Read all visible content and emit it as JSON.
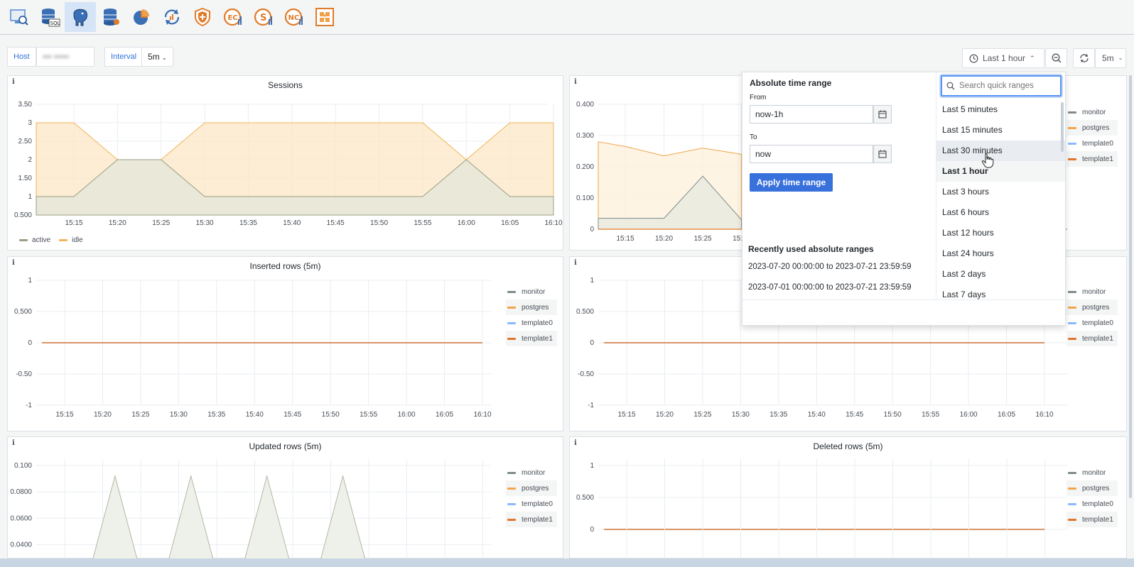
{
  "toolbar": {
    "icons": [
      {
        "name": "monitor-search-icon",
        "color": "#5b8fd3"
      },
      {
        "name": "sql-database-icon",
        "color": "#3a6fb5"
      },
      {
        "name": "postgresql-elephant-icon",
        "color": "#3a6fb5"
      },
      {
        "name": "database-stack-icon",
        "color": "#3a6fb5"
      },
      {
        "name": "pie-chart-icon",
        "color": "#e07b2a"
      },
      {
        "name": "refresh-chart-icon",
        "color": "#3a6fb5"
      },
      {
        "name": "shield-plus-icon",
        "color": "#e07b2a"
      },
      {
        "name": "ec-coin-icon",
        "color": "#e07b2a",
        "text": "EC"
      },
      {
        "name": "s-coin-icon",
        "color": "#e07b2a",
        "text": "S"
      },
      {
        "name": "nc-coin-icon",
        "color": "#e07b2a",
        "text": "NC"
      },
      {
        "name": "puzzle-frame-icon",
        "color": "#e07b2a"
      }
    ]
  },
  "variables": {
    "host_label": "Host",
    "host_value": "••• •••••",
    "interval_label": "Interval",
    "interval_value": "5m"
  },
  "timecontrols": {
    "range_label": "Last 1 hour",
    "refresh_label": "5m"
  },
  "colors": {
    "accent": "#3871dc",
    "monitor": "#7f8b8b",
    "postgres": "#f2a54a",
    "template0": "#8ab8ff",
    "template1": "#e0752d",
    "active": "#9a9f84",
    "idle": "#f2b45a"
  },
  "panels": {
    "sessions": {
      "title": "Sessions",
      "info": "i"
    },
    "top_right": {
      "title": "",
      "info": "i"
    },
    "inserted": {
      "title": "Inserted rows (5m)",
      "info": "i"
    },
    "mid_right": {
      "title": "",
      "info": "i"
    },
    "updated": {
      "title": "Updated rows (5m)",
      "info": "i"
    },
    "deleted": {
      "title": "Deleted rows (5m)",
      "info": "i"
    }
  },
  "legend_db": [
    "monitor",
    "postgres",
    "template0",
    "template1"
  ],
  "legend_sessions": [
    "active",
    "idle"
  ],
  "time_ticks": [
    "15:15",
    "15:20",
    "15:25",
    "15:30",
    "15:35",
    "15:40",
    "15:45",
    "15:50",
    "15:55",
    "16:00",
    "16:05",
    "16:10"
  ],
  "chart_data": [
    {
      "type": "area",
      "title": "Sessions",
      "x": [
        "15:12",
        "15:15",
        "15:20",
        "15:25",
        "15:30",
        "15:35",
        "15:40",
        "15:45",
        "15:50",
        "15:55",
        "16:00",
        "16:05",
        "16:10"
      ],
      "series": [
        {
          "name": "active",
          "values": [
            1,
            1,
            2,
            2,
            1,
            1,
            1,
            1,
            1,
            1,
            2,
            1,
            1
          ]
        },
        {
          "name": "idle",
          "values": [
            3,
            3,
            2,
            2,
            3,
            3,
            3,
            3,
            3,
            3,
            2,
            3,
            3
          ]
        }
      ],
      "yticks": [
        "0.500",
        "1",
        "1.50",
        "2",
        "2.50",
        "3",
        "3.50"
      ],
      "ylim": [
        0.5,
        3.5
      ]
    },
    {
      "type": "area",
      "title": "",
      "x": [
        "15:12",
        "15:15",
        "15:20",
        "15:25",
        "15:30"
      ],
      "series": [
        {
          "name": "postgres",
          "values": [
            0.28,
            0.265,
            0.235,
            0.26,
            0.24
          ]
        },
        {
          "name": "monitor",
          "values": [
            0.035,
            0.035,
            0.035,
            0.17,
            0.03
          ]
        }
      ],
      "yticks": [
        "0",
        "0.100",
        "0.200",
        "0.300",
        "0.400"
      ],
      "ylim": [
        0,
        0.4
      ]
    },
    {
      "type": "line",
      "title": "Inserted rows (5m)",
      "x": [
        "15:15",
        "16:10"
      ],
      "series": [
        {
          "name": "monitor",
          "values": [
            0,
            0
          ]
        },
        {
          "name": "postgres",
          "values": [
            0,
            0
          ]
        },
        {
          "name": "template0",
          "values": [
            0,
            0
          ]
        },
        {
          "name": "template1",
          "values": [
            0,
            0
          ]
        }
      ],
      "yticks": [
        "-1",
        "-0.50",
        "0",
        "0.500",
        "1"
      ],
      "ylim": [
        -1,
        1
      ]
    },
    {
      "type": "line",
      "title": "",
      "x": [
        "15:15",
        "16:10"
      ],
      "series": [
        {
          "name": "monitor",
          "values": [
            0,
            0
          ]
        },
        {
          "name": "postgres",
          "values": [
            0,
            0
          ]
        },
        {
          "name": "template0",
          "values": [
            0,
            0
          ]
        },
        {
          "name": "template1",
          "values": [
            0,
            0
          ]
        }
      ],
      "yticks": [
        "-1",
        "-0.50",
        "0",
        "0.500",
        "1"
      ],
      "ylim": [
        -1,
        1
      ]
    },
    {
      "type": "area",
      "title": "Updated rows (5m)",
      "x": [
        "15:20",
        "15:25",
        "15:30",
        "15:35",
        "15:40",
        "15:45",
        "15:50",
        "15:55"
      ],
      "series": [
        {
          "name": "monitor",
          "peaks_at": [
            "15:22",
            "15:32",
            "15:42",
            "15:52"
          ],
          "peak_value": 0.092
        }
      ],
      "yticks": [
        "0.0400",
        "0.0600",
        "0.0800",
        "0.100"
      ],
      "ylim": [
        0.03,
        0.1
      ]
    },
    {
      "type": "line",
      "title": "Deleted rows (5m)",
      "x": [
        "15:15",
        "16:10"
      ],
      "series": [
        {
          "name": "monitor",
          "values": [
            0,
            0
          ]
        },
        {
          "name": "postgres",
          "values": [
            0,
            0
          ]
        },
        {
          "name": "template0",
          "values": [
            0,
            0
          ]
        },
        {
          "name": "template1",
          "values": [
            0,
            0
          ]
        }
      ],
      "yticks": [
        "0",
        "0.500",
        "1"
      ],
      "ylim": [
        0,
        1
      ]
    }
  ],
  "picker": {
    "abs_title": "Absolute time range",
    "from_label": "From",
    "from_value": "now-1h",
    "to_label": "To",
    "to_value": "now",
    "apply_label": "Apply time range",
    "recent_title": "Recently used absolute ranges",
    "recent": [
      "2023-07-20 00:00:00 to 2023-07-21 23:59:59",
      "2023-07-01 00:00:00 to 2023-07-21 23:59:59"
    ],
    "search_placeholder": "Search quick ranges",
    "quick": [
      "Last 5 minutes",
      "Last 15 minutes",
      "Last 30 minutes",
      "Last 1 hour",
      "Last 3 hours",
      "Last 6 hours",
      "Last 12 hours",
      "Last 24 hours",
      "Last 2 days",
      "Last 7 days"
    ],
    "hover_index": 2,
    "selected_index": 3
  }
}
